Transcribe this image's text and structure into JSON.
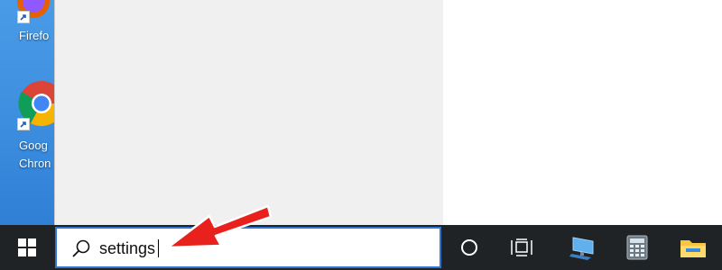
{
  "desktop": {
    "icons": [
      {
        "name": "firefox",
        "label": "Firefo"
      },
      {
        "name": "chrome",
        "label": "Goog\nChron"
      }
    ]
  },
  "taskbar": {
    "search": {
      "value": "settings",
      "icon": "search-icon"
    },
    "items": [
      {
        "name": "cortana",
        "icon": "circle-icon"
      },
      {
        "name": "task-view",
        "icon": "task-view-icon"
      },
      {
        "name": "this-pc",
        "icon": "computer-icon"
      },
      {
        "name": "calculator",
        "icon": "calculator-icon"
      },
      {
        "name": "file-explorer",
        "icon": "folder-icon"
      }
    ]
  },
  "colors": {
    "taskbar": "#1f2326",
    "search_border": "#2e77d0",
    "arrow": "#e8211c",
    "start_menu": "#f0f0f0"
  }
}
